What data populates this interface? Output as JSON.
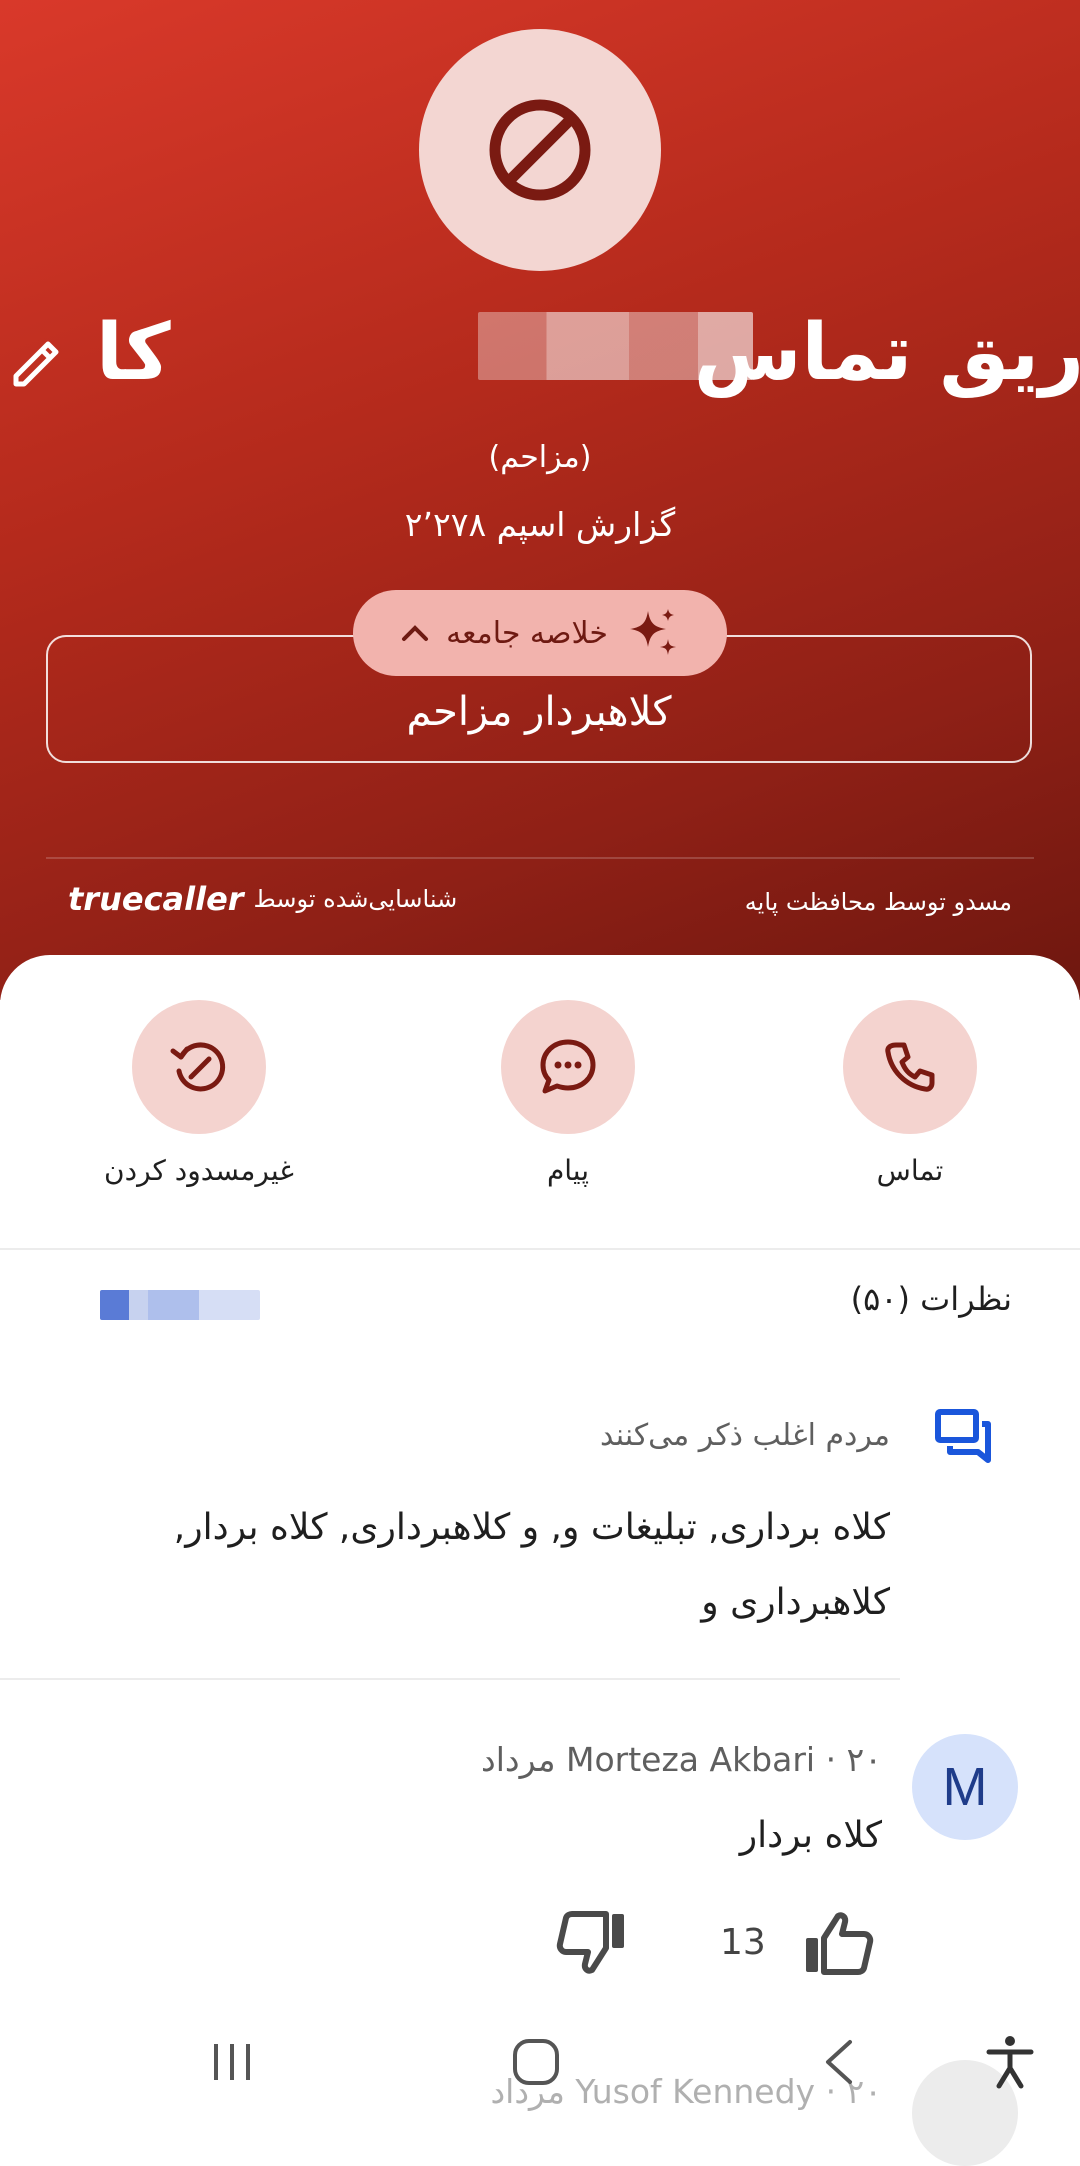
{
  "header": {
    "name_right": "ریق تماس",
    "name_left": "کا",
    "spam_tag": "(مزاحم)",
    "spam_reports": "۲٬۲۷۸ گزارش اسپم",
    "summary_pill_label": "خلاصه جامعه",
    "summary_text": "کلاهبردار مزاحم",
    "identified_by": "شناسایی‌شده توسط",
    "truecaller_logo": "truecaller",
    "blocked_by": "مسدو    توسط محافظت پایه"
  },
  "actions": [
    {
      "label": "تماس",
      "icon": "phone-icon"
    },
    {
      "label": "پیام",
      "icon": "message-icon"
    },
    {
      "label": "غیرمسدود کردن",
      "icon": "unblock-icon"
    }
  ],
  "reviews": {
    "title": "نظرات (۵۰)",
    "link_label": "نظر"
  },
  "mentions": {
    "heading": "مردم اغلب ذکر می‌کنند",
    "body": "کلاه برداری, تبلیغات و, و کلاهبرداری, کلاه بردار, کلاهبرداری و"
  },
  "comment": {
    "avatar_letter": "M",
    "meta": "Morteza Akbari · ۲۰ مرداد",
    "text": "کلاه بردار",
    "likes": "13"
  },
  "next_comment": {
    "meta": "Yusof Kennedy · ۲۰ مرداد"
  },
  "colors": {
    "hero_top": "#d9392a",
    "hero_bottom": "#6e170f",
    "accent_pink": "#f4d3cf",
    "icon_dark_red": "#7a1a12",
    "link_blue": "#1a56db"
  }
}
